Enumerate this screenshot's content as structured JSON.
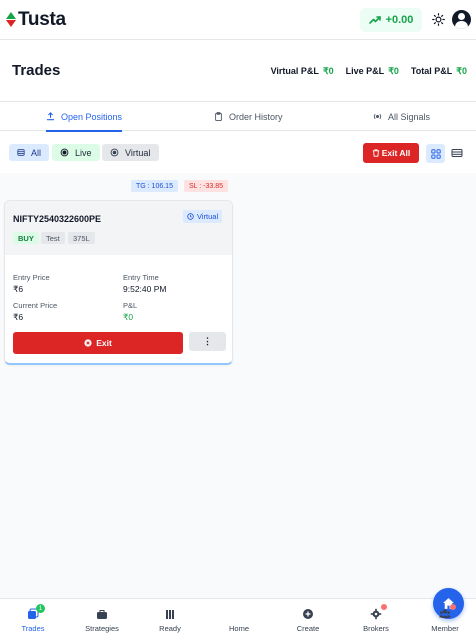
{
  "app": {
    "name": "Tusta"
  },
  "topbar": {
    "pnl_value": "+0.00",
    "pnl_icon": "trending-up-icon",
    "theme_icon": "sun-icon",
    "avatar_icon": "user-icon"
  },
  "page": {
    "title": "Trades"
  },
  "summary": [
    {
      "label": "Virtual P&L",
      "value": "₹0"
    },
    {
      "label": "Live P&L",
      "value": "₹0"
    },
    {
      "label": "Total P&L",
      "value": "₹0"
    }
  ],
  "tabs": [
    {
      "label": "Open Positions",
      "icon": "user-upload-icon",
      "active": true
    },
    {
      "label": "Order History",
      "icon": "clipboard-icon",
      "active": false
    },
    {
      "label": "All Signals",
      "icon": "signal-icon",
      "active": false
    }
  ],
  "filters": {
    "all": "All",
    "live": "Live",
    "virtual": "Virtual"
  },
  "actions": {
    "exit_all": "Exit All"
  },
  "position": {
    "tg_label": "TG : 106.15",
    "sl_label": "SL : -33.85",
    "symbol": "NIFTY2540322600PE",
    "mode": "Virtual",
    "side": "BUY",
    "strategy": "Test",
    "quantity": "375L",
    "entry_price_label": "Entry Price",
    "entry_price": "₹6",
    "entry_time_label": "Entry Time",
    "entry_time": "9:52:40 PM",
    "current_price_label": "Current Price",
    "current_price": "₹6",
    "pnl_label": "P&L",
    "pnl": "₹0",
    "exit_label": "Exit",
    "more_label": "⋮"
  },
  "nav": [
    {
      "label": "Trades",
      "icon": "trades-icon",
      "active": true,
      "count": "1"
    },
    {
      "label": "Strategies",
      "icon": "briefcase-icon",
      "active": false
    },
    {
      "label": "Ready",
      "icon": "bars-icon",
      "active": false
    },
    {
      "label": "Home",
      "icon": "home-icon",
      "active": false
    },
    {
      "label": "Create",
      "icon": "plus-circle-icon",
      "active": false
    },
    {
      "label": "Brokers",
      "icon": "gear-icon",
      "active": false
    },
    {
      "label": "Member",
      "icon": "users-icon",
      "active": false
    }
  ],
  "colors": {
    "accent": "#2563eb",
    "danger": "#dc2626",
    "success": "#16a34a"
  }
}
